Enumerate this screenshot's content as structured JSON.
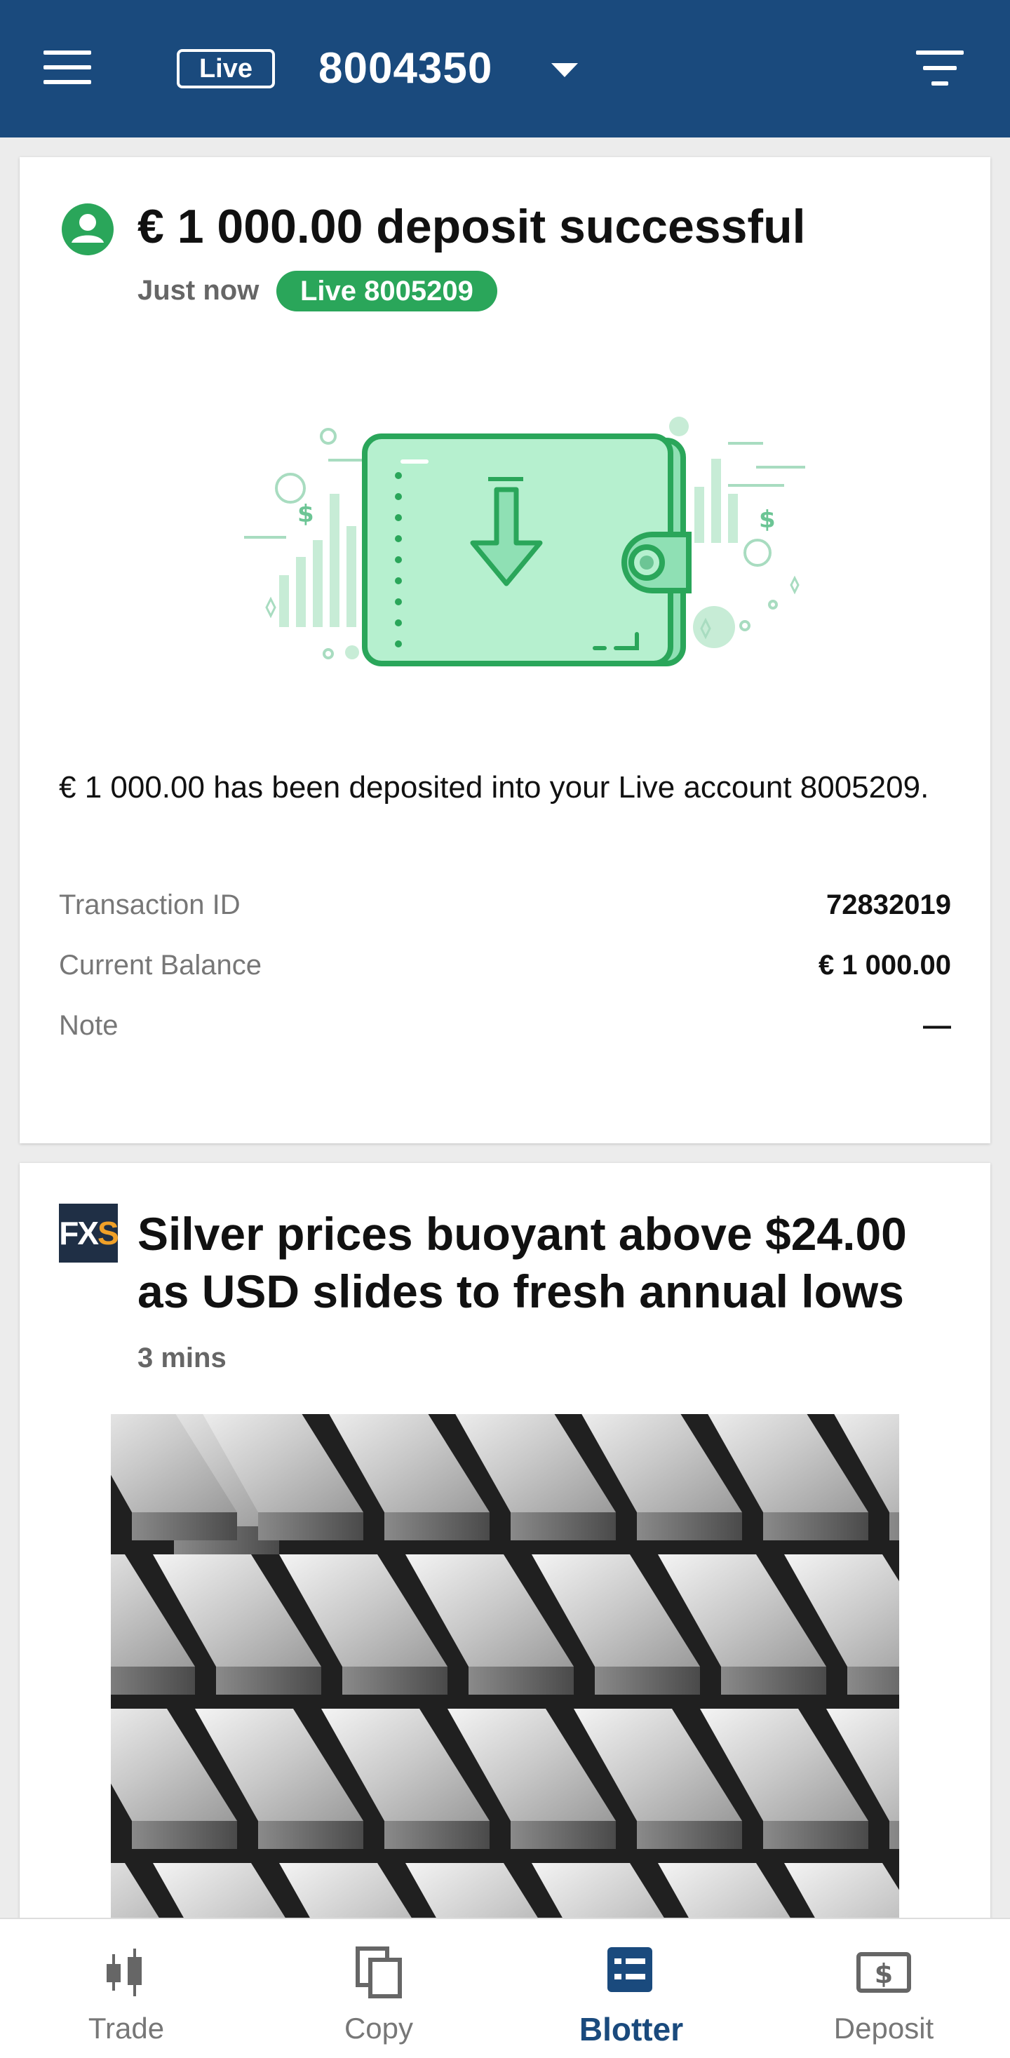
{
  "header": {
    "account_type": "Live",
    "account_number": "8004350"
  },
  "deposit_card": {
    "title": "€ 1 000.00 deposit successful",
    "time": "Just now",
    "account_pill": "Live 8005209",
    "message": "€ 1 000.00 has been deposited into your Live account 8005209.",
    "details": [
      {
        "label": "Transaction ID",
        "value": "72832019"
      },
      {
        "label": "Current Balance",
        "value": "€ 1 000.00"
      },
      {
        "label": "Note",
        "value": "—"
      }
    ],
    "colors": {
      "success": "#2aa65a"
    }
  },
  "news_card": {
    "logo_text_a": "FX",
    "logo_text_b": "S",
    "title": "Silver prices buoyant above $24.00 as USD slides to fresh annual lows",
    "time": "3 mins"
  },
  "bottom_nav": {
    "items": [
      {
        "label": "Trade",
        "icon": "candlestick-icon"
      },
      {
        "label": "Copy",
        "icon": "copy-icon"
      },
      {
        "label": "Blotter",
        "icon": "blotter-icon",
        "active": true
      },
      {
        "label": "Deposit",
        "icon": "deposit-icon"
      }
    ],
    "active_color": "#1a4a7d"
  }
}
